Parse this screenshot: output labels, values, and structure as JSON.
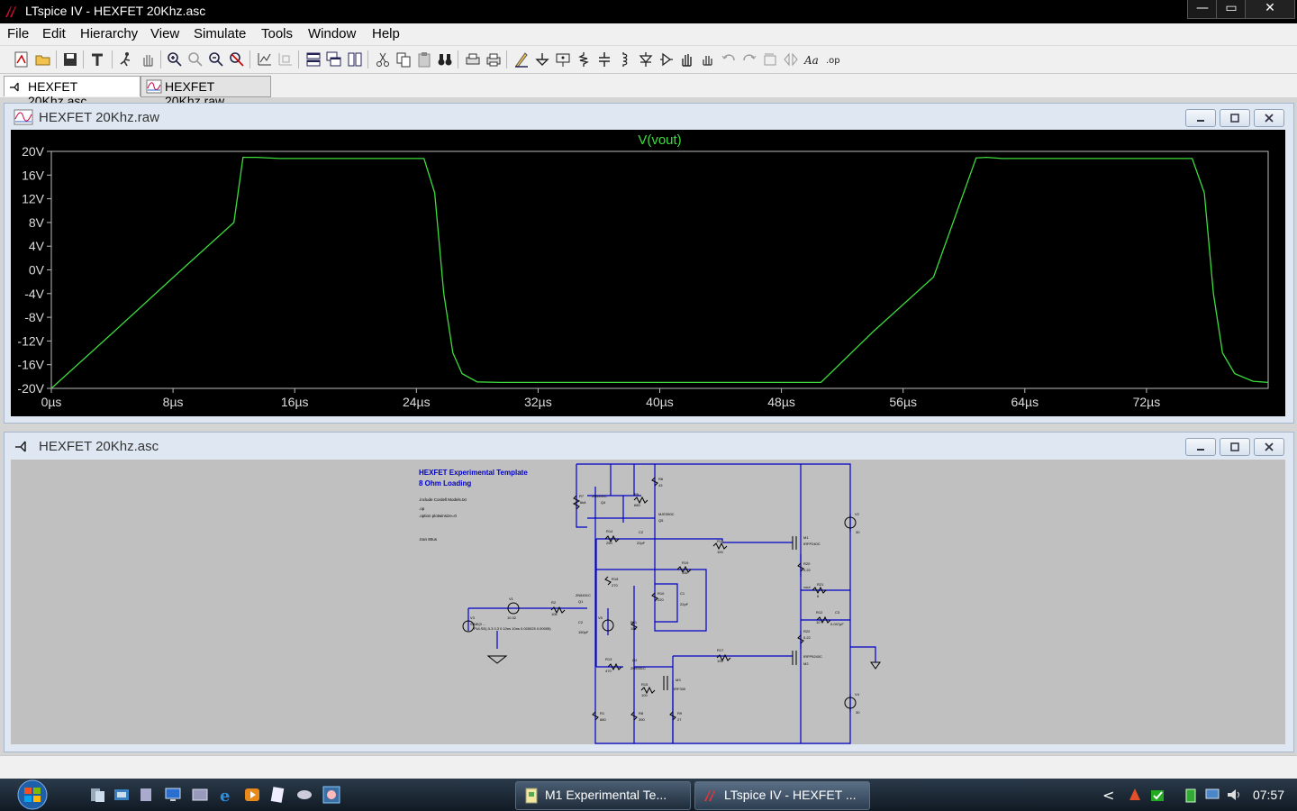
{
  "window": {
    "title": "LTspice IV - HEXFET 20Khz.asc",
    "min": "—",
    "max": "▭",
    "close": "✕"
  },
  "menu": [
    "File",
    "Edit",
    "Hierarchy",
    "View",
    "Simulate",
    "Tools",
    "Window",
    "Help"
  ],
  "tabs": [
    {
      "label": "HEXFET 20Khz.asc",
      "active": true
    },
    {
      "label": "HEXFET 20Khz.raw",
      "active": false
    }
  ],
  "waveform_window": {
    "title": "HEXFET 20Khz.raw"
  },
  "schematic_window": {
    "title": "HEXFET 20Khz.asc"
  },
  "chart_data": {
    "type": "line",
    "title": "",
    "series": [
      {
        "name": "V(vout)",
        "color": "#3cdc3c",
        "x": [
          0,
          4,
          8,
          12,
          12.6,
          13.5,
          15,
          20,
          24.5,
          25.2,
          25.8,
          26.4,
          27,
          28,
          29.5,
          32,
          36,
          40,
          44,
          48,
          50.6,
          54,
          58,
          60.8,
          61.5,
          62.5,
          66,
          70,
          75,
          75.8,
          76.4,
          77,
          77.8,
          79,
          80
        ],
        "y": [
          -20,
          -10.7,
          -1.3,
          8,
          19,
          19,
          18.8,
          18.8,
          18.8,
          13,
          -4,
          -14,
          -17.5,
          -18.9,
          -19,
          -19,
          -19,
          -19,
          -19,
          -19,
          -19,
          -10.5,
          -1.2,
          18.9,
          19,
          18.8,
          18.8,
          18.8,
          18.8,
          13,
          -4,
          -14,
          -17.5,
          -18.8,
          -19
        ]
      }
    ],
    "ylabel_ticks": [
      "20V",
      "16V",
      "12V",
      "8V",
      "4V",
      "0V",
      "-4V",
      "-8V",
      "-12V",
      "-16V",
      "-20V"
    ],
    "y_values": [
      20,
      16,
      12,
      8,
      4,
      0,
      -4,
      -8,
      -12,
      -16,
      -20
    ],
    "xlabel_ticks": [
      "0µs",
      "8µs",
      "16µs",
      "24µs",
      "32µs",
      "40µs",
      "48µs",
      "56µs",
      "64µs",
      "72µs"
    ],
    "x_values": [
      0,
      8,
      16,
      24,
      32,
      40,
      48,
      56,
      64,
      72
    ],
    "xlim": [
      0,
      80
    ],
    "ylim": [
      -20,
      20
    ],
    "grid": false,
    "background": "#000000",
    "axis_color": "#bbbbbb"
  },
  "schematic": {
    "title": "HEXFET Experimental Template",
    "subtitle": "8 Ohm Loading",
    "directives": [
      ".include Cordell Models.txt",
      ".op",
      ".option plotwinsize=0",
      ".tran 80us"
    ],
    "labels": [
      {
        "t": "R7",
        "k": "r7"
      },
      {
        "t": "6k8",
        "k": "r7v"
      },
      {
        "t": "2N5401C",
        "k": "q4m"
      },
      {
        "t": "Q4",
        "k": "q4"
      },
      {
        "t": "R5",
        "k": "r5"
      },
      {
        "t": "680",
        "k": "r5v"
      },
      {
        "t": "R6",
        "k": "r6"
      },
      {
        "t": "43",
        "k": "r6v"
      },
      {
        "t": "MJE350C",
        "k": "q5m"
      },
      {
        "t": "Q5",
        "k": "q5"
      },
      {
        "t": "R14",
        "k": "r14"
      },
      {
        "t": "250",
        "k": "r14v"
      },
      {
        "t": "C2",
        "k": "c2"
      },
      {
        "t": "22pF",
        "k": "c2v"
      },
      {
        "t": "R16",
        "k": "r16"
      },
      {
        "t": "100",
        "k": "r16v"
      },
      {
        "t": "M1",
        "k": "m1"
      },
      {
        "t": "IRFP240C",
        "k": "m1m"
      },
      {
        "t": "R19",
        "k": "r19"
      },
      {
        "t": "15k",
        "k": "r19v"
      },
      {
        "t": "R18",
        "k": "r18"
      },
      {
        "t": "270",
        "k": "r18v"
      },
      {
        "t": "R20",
        "k": "r20"
      },
      {
        "t": "0.22",
        "k": "r20v"
      },
      {
        "t": "R10",
        "k": "r10"
      },
      {
        "t": "220",
        "k": "r10v"
      },
      {
        "t": "C1",
        "k": "c1"
      },
      {
        "t": "22pF",
        "k": "c1v"
      },
      {
        "t": "vout",
        "k": "vout"
      },
      {
        "t": "R21",
        "k": "r21"
      },
      {
        "t": "8",
        "k": "r21v"
      },
      {
        "t": "V1",
        "k": "v1"
      },
      {
        "t": "10.32",
        "k": "v1v"
      },
      {
        "t": "R2",
        "k": "r2"
      },
      {
        "t": "10k",
        "k": "r2v"
      },
      {
        "t": "2N5401C",
        "k": "q1m"
      },
      {
        "t": "Q1",
        "k": "q1"
      },
      {
        "t": "V5",
        "k": "v5"
      },
      {
        "t": "V3",
        "k": "v3"
      },
      {
        "t": "SINE(0 ...",
        "k": "v3v"
      },
      {
        "t": "PULSE(-0.3 0.3 0 10ns 10ns 0.000025 0.00005)",
        "k": "pulse"
      },
      {
        "t": "C2",
        "k": "c2b"
      },
      {
        "t": "150pF",
        "k": "c2bv"
      },
      {
        "t": "R11",
        "k": "r11"
      },
      {
        "t": "15k",
        "k": "r11v"
      },
      {
        "t": "R12",
        "k": "r12"
      },
      {
        "t": "10",
        "k": "r12v"
      },
      {
        "t": "C3",
        "k": "c3"
      },
      {
        "t": "0.047µF",
        "k": "c3v"
      },
      {
        "t": "R22",
        "k": "r22"
      },
      {
        "t": "0.22",
        "k": "r22v"
      },
      {
        "t": "R17",
        "k": "r17"
      },
      {
        "t": "100",
        "k": "r17v"
      },
      {
        "t": "IRFP9240C",
        "k": "m2m"
      },
      {
        "t": "M2",
        "k": "m2"
      },
      {
        "t": "R13",
        "k": "r13"
      },
      {
        "t": "470",
        "k": "r13v"
      },
      {
        "t": "Q2",
        "k": "q2"
      },
      {
        "t": "2N5551C",
        "k": "q2m"
      },
      {
        "t": "M3",
        "k": "m3"
      },
      {
        "t": "IRF330",
        "k": "m3m"
      },
      {
        "t": "R15",
        "k": "r15"
      },
      {
        "t": "100",
        "k": "r15v"
      },
      {
        "t": "R1",
        "k": "r1"
      },
      {
        "t": "680",
        "k": "r1v"
      },
      {
        "t": "R8",
        "k": "r8"
      },
      {
        "t": "390",
        "k": "r8v"
      },
      {
        "t": "R9",
        "k": "r9"
      },
      {
        "t": "27",
        "k": "r9v"
      },
      {
        "t": "V2",
        "k": "v2"
      },
      {
        "t": "30",
        "k": "v2v"
      },
      {
        "t": "V4",
        "k": "v4"
      },
      {
        "t": "30",
        "k": "v4v"
      }
    ]
  },
  "taskbar": {
    "tasks": [
      {
        "label": "M1 Experimental Te..."
      },
      {
        "label": "LTspice IV - HEXFET ..."
      }
    ],
    "clock": "07:57"
  }
}
